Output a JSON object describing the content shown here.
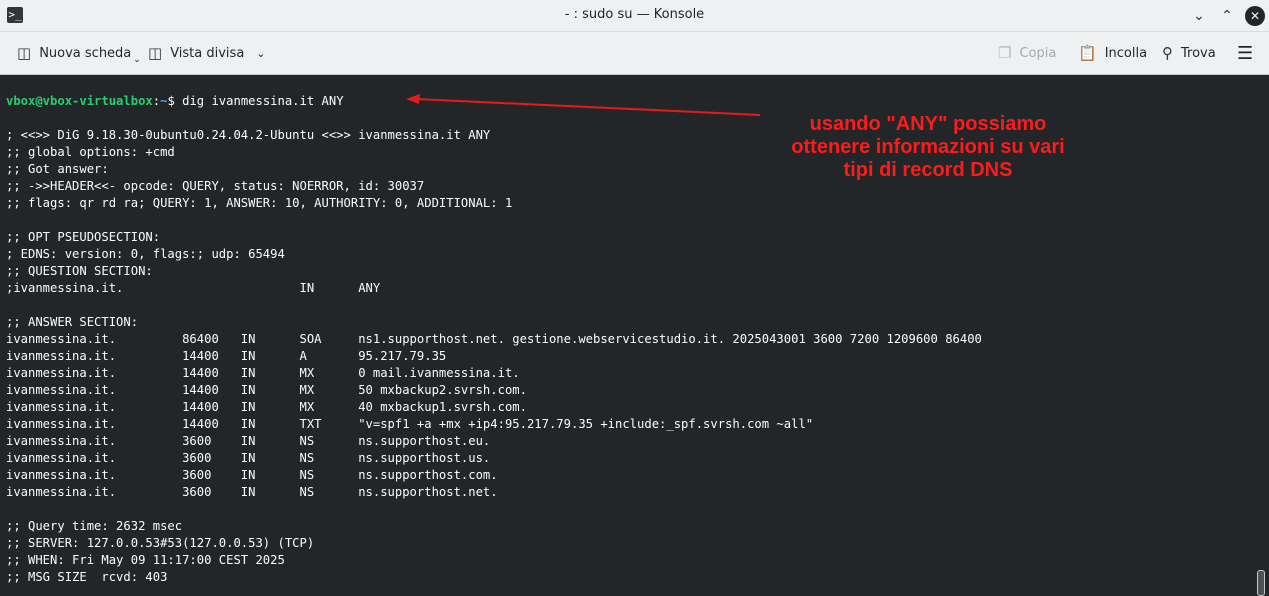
{
  "window": {
    "title": "- : sudo su — Konsole",
    "app_icon": "terminal-app-icon"
  },
  "toolbar": {
    "new_tab": "Nuova scheda",
    "split_view": "Vista divisa",
    "copy": "Copia",
    "paste": "Incolla",
    "find": "Trova"
  },
  "prompt": {
    "user_host": "vbox@vbox-virtualbox",
    "sep": ":",
    "path": "~",
    "symbol": "$",
    "command": " dig ivanmessina.it ANY"
  },
  "output": [
    "; <<>> DiG 9.18.30-0ubuntu0.24.04.2-Ubuntu <<>> ivanmessina.it ANY",
    ";; global options: +cmd",
    ";; Got answer:",
    ";; ->>HEADER<<- opcode: QUERY, status: NOERROR, id: 30037",
    ";; flags: qr rd ra; QUERY: 1, ANSWER: 10, AUTHORITY: 0, ADDITIONAL: 1",
    "",
    ";; OPT PSEUDOSECTION:",
    "; EDNS: version: 0, flags:; udp: 65494",
    ";; QUESTION SECTION:",
    ";ivanmessina.it.                        IN      ANY",
    "",
    ";; ANSWER SECTION:",
    "ivanmessina.it.         86400   IN      SOA     ns1.supporthost.net. gestione.webservicestudio.it. 2025043001 3600 7200 1209600 86400",
    "ivanmessina.it.         14400   IN      A       95.217.79.35",
    "ivanmessina.it.         14400   IN      MX      0 mail.ivanmessina.it.",
    "ivanmessina.it.         14400   IN      MX      50 mxbackup2.svrsh.com.",
    "ivanmessina.it.         14400   IN      MX      40 mxbackup1.svrsh.com.",
    "ivanmessina.it.         14400   IN      TXT     \"v=spf1 +a +mx +ip4:95.217.79.35 +include:_spf.svrsh.com ~all\"",
    "ivanmessina.it.         3600    IN      NS      ns.supporthost.eu.",
    "ivanmessina.it.         3600    IN      NS      ns.supporthost.us.",
    "ivanmessina.it.         3600    IN      NS      ns.supporthost.com.",
    "ivanmessina.it.         3600    IN      NS      ns.supporthost.net.",
    "",
    ";; Query time: 2632 msec",
    ";; SERVER: 127.0.0.53#53(127.0.0.53) (TCP)",
    ";; WHEN: Fri May 09 11:17:00 CEST 2025",
    ";; MSG SIZE  rcvd: 403"
  ],
  "annotation": {
    "lines": [
      "usando \"ANY\" possiamo",
      "ottenere informazioni su vari",
      "tipi di record DNS"
    ],
    "color": "#ff1a1a"
  }
}
